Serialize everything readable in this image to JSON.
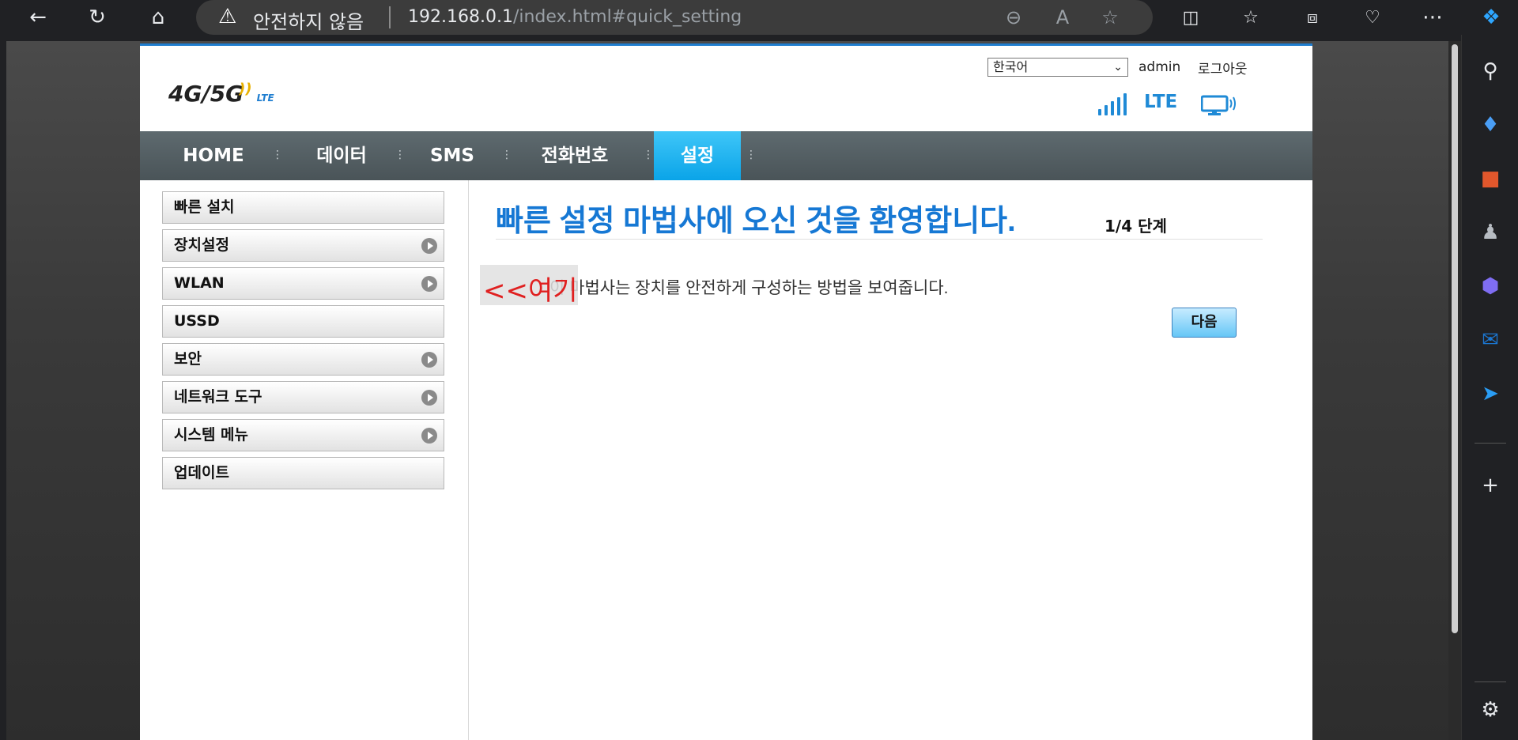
{
  "browser": {
    "warning_text": "안전하지 않음",
    "url_host": "192.168.0.1",
    "url_path": "/index.html#quick_setting"
  },
  "router": {
    "logo_text": "4G/5G",
    "logo_sub": "LTE",
    "language": "한국어",
    "admin_label": "admin",
    "logout_label": "로그아웃",
    "network_type": "LTE",
    "nav": [
      {
        "label": "HOME"
      },
      {
        "label": "데이터"
      },
      {
        "label": "SMS"
      },
      {
        "label": "전화번호"
      },
      {
        "label": "설정"
      }
    ],
    "menu": [
      {
        "label": "빠른 설치",
        "has_arrow": false
      },
      {
        "label": "장치설정",
        "has_arrow": true
      },
      {
        "label": "WLAN",
        "has_arrow": true
      },
      {
        "label": "USSD",
        "has_arrow": false
      },
      {
        "label": "보안",
        "has_arrow": true
      },
      {
        "label": "네트워크 도구",
        "has_arrow": true
      },
      {
        "label": "시스템 메뉴",
        "has_arrow": true
      },
      {
        "label": "업데이트",
        "has_arrow": false
      }
    ],
    "wizard": {
      "heading": "빠른 설정 마법사에 오신 것을 환영합니다.",
      "step": "1/4 단계",
      "description": "이 마법사는 장치를 안전하게 구성하는 방법을 보여줍니다.",
      "next_label": "다음"
    },
    "annotation": "<<여기"
  }
}
